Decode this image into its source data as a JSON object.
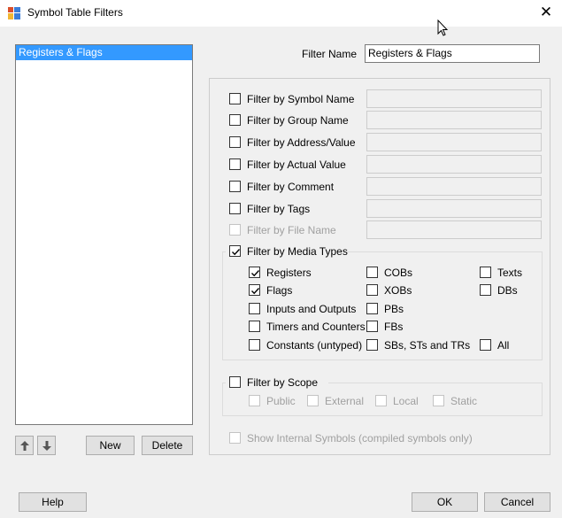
{
  "window": {
    "title": "Symbol Table Filters",
    "close_label": "✕"
  },
  "filter_list": {
    "items": [
      {
        "label": "Registers & Flags",
        "selected": true
      }
    ]
  },
  "list_buttons": {
    "up_icon": "arrow-up-icon",
    "down_icon": "arrow-down-icon",
    "new_label": "New",
    "delete_label": "Delete"
  },
  "filter_name": {
    "label": "Filter Name",
    "value": "Registers & Flags"
  },
  "filters": {
    "symbol_name": {
      "label": "Filter by Symbol Name",
      "checked": false,
      "value": ""
    },
    "group_name": {
      "label": "Filter by Group Name",
      "checked": false,
      "value": ""
    },
    "address_value": {
      "label": "Filter by Address/Value",
      "checked": false,
      "value": ""
    },
    "actual_value": {
      "label": "Filter by Actual Value",
      "checked": false,
      "value": ""
    },
    "comment": {
      "label": "Filter by Comment",
      "checked": false,
      "value": ""
    },
    "tags": {
      "label": "Filter by Tags",
      "checked": false,
      "value": ""
    },
    "file_name": {
      "label": "Filter by File Name",
      "checked": false,
      "value": "",
      "disabled": true
    }
  },
  "media_types": {
    "label": "Filter by Media Types",
    "checked": true,
    "options": {
      "registers": {
        "label": "Registers",
        "checked": true
      },
      "flags": {
        "label": "Flags",
        "checked": true
      },
      "inputs_outputs": {
        "label": "Inputs and Outputs",
        "checked": false
      },
      "timers_counters": {
        "label": "Timers and Counters",
        "checked": false
      },
      "constants": {
        "label": "Constants (untyped)",
        "checked": false
      },
      "cobs": {
        "label": "COBs",
        "checked": false
      },
      "xobs": {
        "label": "XOBs",
        "checked": false
      },
      "pbs": {
        "label": "PBs",
        "checked": false
      },
      "fbs": {
        "label": "FBs",
        "checked": false
      },
      "sbs": {
        "label": "SBs, STs and TRs",
        "checked": false
      },
      "texts": {
        "label": "Texts",
        "checked": false
      },
      "dbs": {
        "label": "DBs",
        "checked": false
      },
      "all": {
        "label": "All",
        "checked": false
      }
    }
  },
  "scope": {
    "label": "Filter by Scope",
    "checked": false,
    "options": {
      "public": {
        "label": "Public",
        "checked": false
      },
      "external": {
        "label": "External",
        "checked": false
      },
      "local": {
        "label": "Local",
        "checked": false
      },
      "static": {
        "label": "Static",
        "checked": false
      }
    }
  },
  "internal_symbols": {
    "label": "Show Internal Symbols (compiled symbols only)",
    "checked": false
  },
  "footer": {
    "help_label": "Help",
    "ok_label": "OK",
    "cancel_label": "Cancel"
  }
}
